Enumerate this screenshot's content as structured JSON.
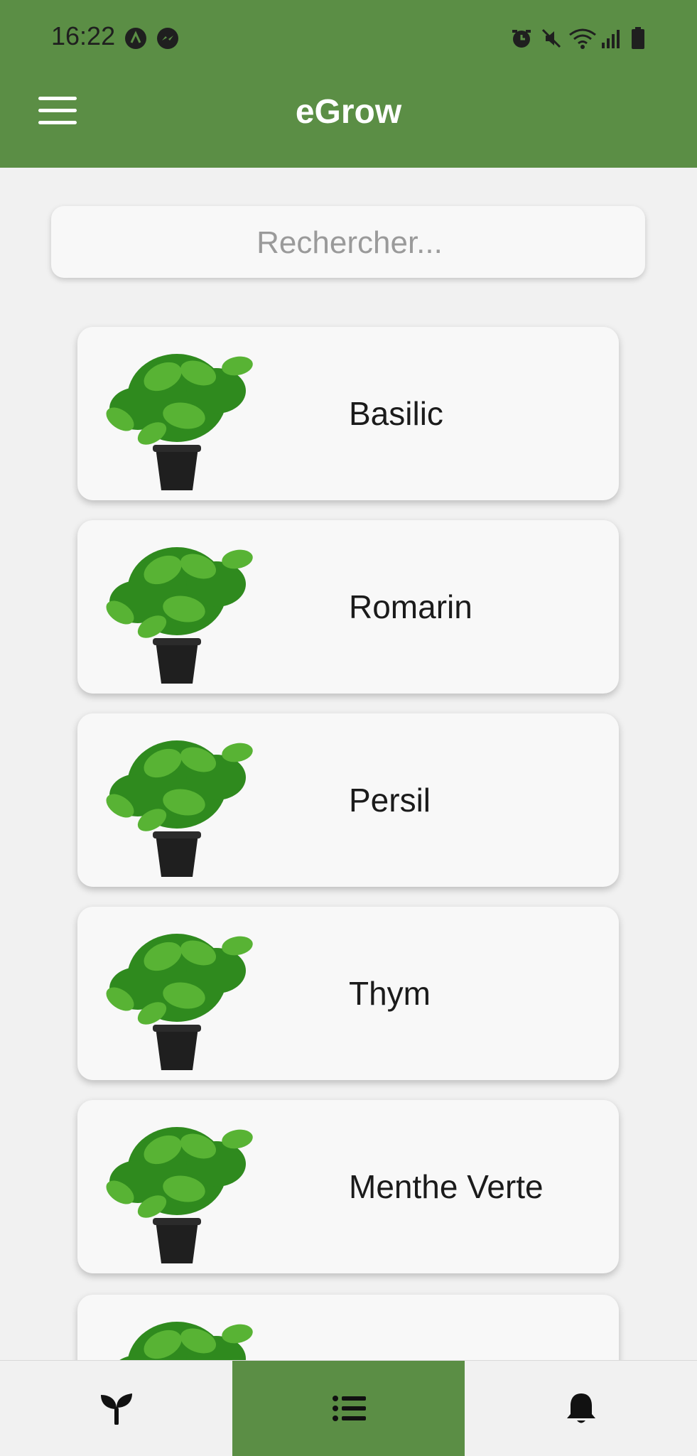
{
  "status_bar": {
    "time": "16:22"
  },
  "app_bar": {
    "title": "eGrow"
  },
  "search": {
    "placeholder": "Rechercher..."
  },
  "plants": [
    {
      "name": "Basilic"
    },
    {
      "name": "Romarin"
    },
    {
      "name": "Persil"
    },
    {
      "name": "Thym"
    },
    {
      "name": "Menthe Verte"
    },
    {
      "name": ""
    }
  ],
  "bottom_nav": {
    "tabs": [
      {
        "icon": "seedling-icon",
        "active": false
      },
      {
        "icon": "list-icon",
        "active": true
      },
      {
        "icon": "bell-icon",
        "active": false
      }
    ]
  },
  "colors": {
    "primary": "#5b8e45",
    "background": "#f1f1f1",
    "card": "#f8f8f8"
  }
}
